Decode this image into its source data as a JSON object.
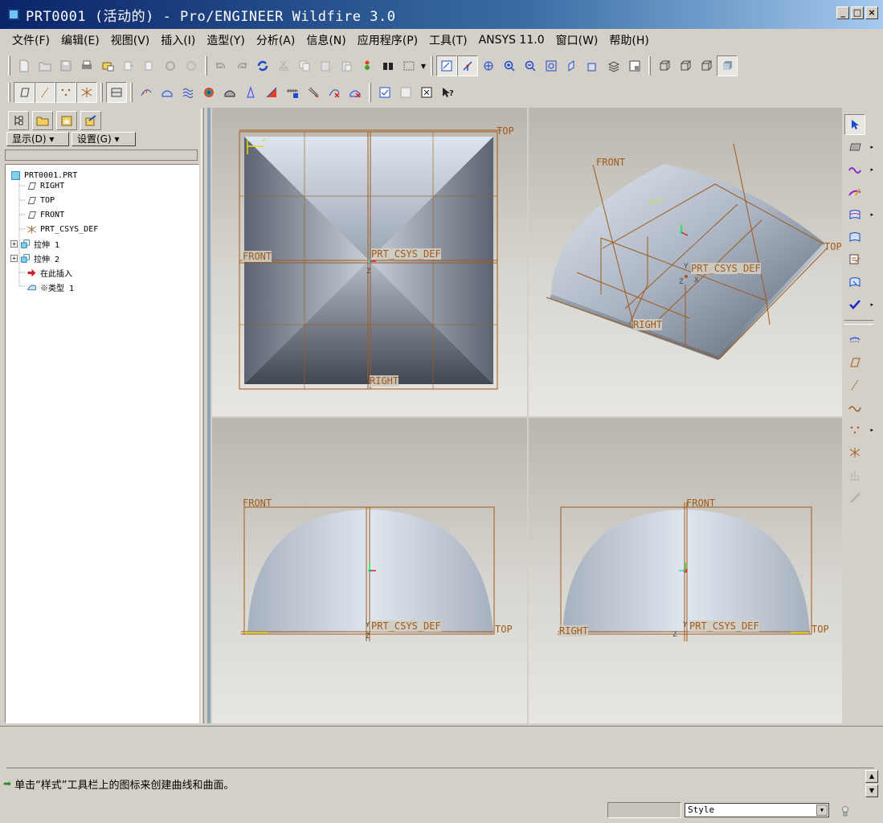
{
  "window": {
    "title": "PRT0001 (活动的) - Pro/ENGINEER Wildfire 3.0"
  },
  "menu": [
    "文件(F)",
    "编辑(E)",
    "视图(V)",
    "插入(I)",
    "造型(Y)",
    "分析(A)",
    "信息(N)",
    "应用程序(P)",
    "工具(T)",
    "ANSYS 11.0",
    "窗口(W)",
    "帮助(H)"
  ],
  "tree": {
    "buttons": {
      "display": "显示(D)",
      "settings": "设置(G)"
    },
    "root": "PRT0001.PRT",
    "nodes": [
      "RIGHT",
      "TOP",
      "FRONT",
      "PRT_CSYS_DEF",
      "拉伸 1",
      "拉伸 2",
      "在此插入",
      "※类型 1"
    ]
  },
  "viewports": {
    "top": {
      "top": "TOP",
      "front": "FRONT",
      "csys": "PRT_CSYS_DEF",
      "right": "RIGHT",
      "z": "Z"
    },
    "iso": {
      "front": "FRONT",
      "top": "TOP",
      "csys": "PRT_CSYS_DEF",
      "right": "RIGHT",
      "z": "Z",
      "x": "X",
      "y": "Y"
    },
    "front_view": {
      "front": "FRONT",
      "csys": "PRT_CSYS_DEF",
      "top": "TOP",
      "y": "Y",
      "z": "Z"
    },
    "side_view": {
      "front": "FRONT",
      "right": "RIGHT",
      "csys": "PRT_CSYS_DEF",
      "top": "TOP",
      "y": "Y",
      "z": "Z"
    }
  },
  "status": {
    "message": "单击“样式”工具栏上的图标来创建曲线和曲面。",
    "filter_value": "Style"
  },
  "colors": {
    "datum": "#a05a1a",
    "surface_light": "#dbe3ec",
    "surface_dark": "#5a6270",
    "titlebar": "#0a246a"
  }
}
